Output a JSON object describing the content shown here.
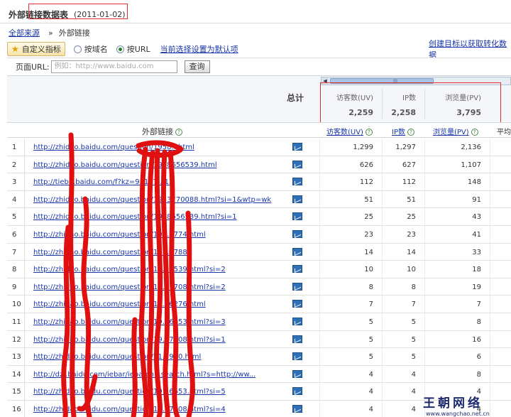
{
  "header": {
    "title": "外部链接数据表",
    "date": "(2011-01-02)"
  },
  "breadcrumb": {
    "root": "全部来源",
    "separator": "»",
    "current": "外部链接"
  },
  "toolbar": {
    "custom_metrics_label": "自定义指标",
    "radio_domain_label": "按域名",
    "radio_url_label": "按URL",
    "radio_selected": "url",
    "set_default_label": "当前选择设置为默认项",
    "create_goal_label": "创建目标以获取转化数据"
  },
  "filter": {
    "label": "页面URL:",
    "placeholder": "例如：http://www.baidu.com",
    "query_button": "查询"
  },
  "summary": {
    "total_label": "总计",
    "columns": [
      {
        "label": "访客数(UV)",
        "value": "2,259"
      },
      {
        "label": "IP数",
        "value": "2,258"
      },
      {
        "label": "浏览量(PV)",
        "value": "3,795"
      }
    ]
  },
  "table": {
    "link_header": "外部链接",
    "col_uv": "访客数(UV)",
    "col_ip": "IP数",
    "col_pv": "浏览量(PV)",
    "col_more": "平均",
    "rows": [
      {
        "n": "1",
        "url": "http://zhidao.baidu.com/question/1958...html",
        "uv": "1,299",
        "ip": "1,297",
        "pv": "2,136"
      },
      {
        "n": "2",
        "url": "http://zhidao.baidu.com/question/1958656539.html",
        "uv": "626",
        "ip": "627",
        "pv": "1,107"
      },
      {
        "n": "3",
        "url": "http://tieba.baidu.com/f?kz=91157...13",
        "uv": "112",
        "ip": "112",
        "pv": "148"
      },
      {
        "n": "4",
        "url": "http://zhidao.baidu.com/question/1953770088.html?si=1&wtp=wk",
        "uv": "51",
        "ip": "51",
        "pv": "91"
      },
      {
        "n": "5",
        "url": "http://zhidao.baidu.com/question/1958656539.html?si=1",
        "uv": "25",
        "ip": "25",
        "pv": "43"
      },
      {
        "n": "6",
        "url": "http://zhidao.baidu.com/question/19...3774.html",
        "uv": "23",
        "ip": "23",
        "pv": "41"
      },
      {
        "n": "7",
        "url": "http://zhidao.baidu.com/question/19...7788",
        "uv": "14",
        "ip": "14",
        "pv": "33"
      },
      {
        "n": "8",
        "url": "http://zhidao.baidu.com/question/19...6539.html?si=2",
        "uv": "10",
        "ip": "10",
        "pv": "18"
      },
      {
        "n": "9",
        "url": "http://zhidao.baidu.com/question/19...7708.html?si=2",
        "uv": "8",
        "ip": "8",
        "pv": "19"
      },
      {
        "n": "10",
        "url": "http://zhidao.baidu.com/question/19...6276.html",
        "uv": "7",
        "ip": "7",
        "pv": "7"
      },
      {
        "n": "11",
        "url": "http://zhidao.baidu.com/question/19...6653.html?si=3",
        "uv": "5",
        "ip": "5",
        "pv": "8"
      },
      {
        "n": "12",
        "url": "http://zhidao.baidu.com/question/19...7708.html?si=1",
        "uv": "5",
        "ip": "5",
        "pv": "16"
      },
      {
        "n": "13",
        "url": "http://zhidao.baidu.com/question/21...940.html",
        "uv": "5",
        "ip": "5",
        "pv": "6"
      },
      {
        "n": "14",
        "url": "http://dzl.baidu.com/iebar/iebarch...search.html?s=http://ww...",
        "uv": "4",
        "ip": "4",
        "pv": "8"
      },
      {
        "n": "15",
        "url": "http://zhidao.baidu.com/question/19...6653.html?si=5",
        "uv": "4",
        "ip": "4",
        "pv": "4"
      },
      {
        "n": "16",
        "url": "http://zhidao.baidu.com/question/19...7708.html?si=4",
        "uv": "4",
        "ip": "4",
        "pv": "4"
      }
    ]
  },
  "watermark": {
    "big": "王朝网络",
    "small": "www.wangchao.net.cn"
  },
  "colors": {
    "link": "#1a37a8",
    "annotation_red": "#e01010",
    "trend_icon": "#2f6fb5"
  }
}
